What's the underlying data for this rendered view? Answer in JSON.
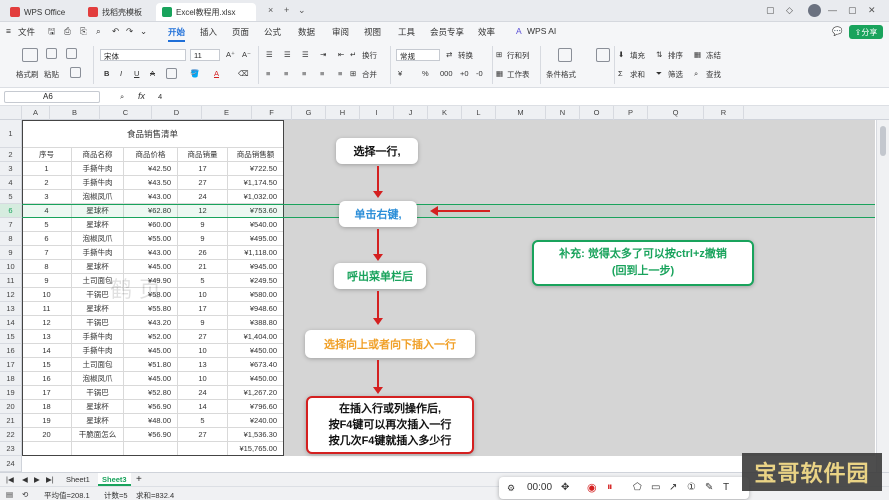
{
  "tabs": [
    {
      "label": "WPS Office",
      "icon_color": "#e23d3d"
    },
    {
      "label": "找稻壳模板",
      "icon_color": "#e23d3d"
    },
    {
      "label": "Excel教程用.xlsx",
      "icon_color": "#19a35c"
    }
  ],
  "menu": {
    "file": "文件",
    "items": [
      "开始",
      "插入",
      "页面",
      "公式",
      "数据",
      "审阅",
      "视图",
      "工具",
      "会员专享",
      "效率"
    ],
    "wps_ai": "WPS AI",
    "share": "分享"
  },
  "ribbon": {
    "format_painter": "格式刷",
    "paste": "粘贴",
    "font_name": "宋体",
    "font_size": "11",
    "wrap": "换行",
    "merge": "合并",
    "number_format": "常规",
    "convert": "转换",
    "row_col": "行和列",
    "worksheet": "工作表",
    "cond_format": "条件格式",
    "fill": "填充",
    "sort": "排序",
    "freeze": "冻结",
    "sum": "求和",
    "filter": "筛选",
    "find": "查找"
  },
  "formula_bar": {
    "cell_ref": "A6",
    "fx": "fx",
    "value": "4"
  },
  "columns": [
    "A",
    "B",
    "C",
    "D",
    "E",
    "F",
    "G",
    "H",
    "I",
    "J",
    "K",
    "L",
    "M",
    "N",
    "O",
    "P",
    "Q",
    "R"
  ],
  "rows": [
    "1",
    "2",
    "3",
    "4",
    "5",
    "6",
    "7",
    "8",
    "9",
    "10",
    "11",
    "12",
    "13",
    "14",
    "15",
    "16",
    "17",
    "18",
    "19",
    "20",
    "21",
    "22",
    "23",
    "24"
  ],
  "table": {
    "title": "食品销售清单",
    "headers": [
      "序号",
      "商品名称",
      "商品价格",
      "商品销量",
      "商品销售额"
    ],
    "data": [
      [
        "1",
        "手撕牛肉",
        "¥42.50",
        "17",
        "¥722.50"
      ],
      [
        "2",
        "手撕牛肉",
        "¥43.50",
        "27",
        "¥1,174.50"
      ],
      [
        "3",
        "泡椒凤爪",
        "¥43.00",
        "24",
        "¥1,032.00"
      ],
      [
        "4",
        "星球杯",
        "¥62.80",
        "12",
        "¥753.60"
      ],
      [
        "5",
        "星球杯",
        "¥60.00",
        "9",
        "¥540.00"
      ],
      [
        "6",
        "泡椒凤爪",
        "¥55.00",
        "9",
        "¥495.00"
      ],
      [
        "7",
        "手撕牛肉",
        "¥43.00",
        "26",
        "¥1,118.00"
      ],
      [
        "8",
        "星球杯",
        "¥45.00",
        "21",
        "¥945.00"
      ],
      [
        "9",
        "土司面包",
        "¥49.90",
        "5",
        "¥249.50"
      ],
      [
        "10",
        "干锅巴",
        "¥58.00",
        "10",
        "¥580.00"
      ],
      [
        "11",
        "星球杯",
        "¥55.80",
        "17",
        "¥948.60"
      ],
      [
        "12",
        "干锅巴",
        "¥43.20",
        "9",
        "¥388.80"
      ],
      [
        "13",
        "手撕牛肉",
        "¥52.00",
        "27",
        "¥1,404.00"
      ],
      [
        "14",
        "手撕牛肉",
        "¥45.00",
        "10",
        "¥450.00"
      ],
      [
        "15",
        "土司面包",
        "¥51.80",
        "13",
        "¥673.40"
      ],
      [
        "16",
        "泡椒凤爪",
        "¥45.00",
        "10",
        "¥450.00"
      ],
      [
        "17",
        "干锅巴",
        "¥52.80",
        "24",
        "¥1,267.20"
      ],
      [
        "18",
        "星球杯",
        "¥56.90",
        "14",
        "¥796.60"
      ],
      [
        "19",
        "星球杯",
        "¥48.00",
        "5",
        "¥240.00"
      ],
      [
        "20",
        "干脆面怎么",
        "¥56.90",
        "27",
        "¥1,536.30"
      ]
    ],
    "total": "¥15,765.00"
  },
  "watermark_text": "鹤 页",
  "annotations": {
    "step1": "选择一行,",
    "step2": "单击右键,",
    "step3": "呼出菜单栏后",
    "step4": "选择向上或者向下插入一行",
    "step5": "在插入行或列操作后,\n按F4键可以再次插入一行\n按几次F4键就插入多少行",
    "tip": "补充: 觉得太多了可以按ctrl+z撤销\n(回到上一步)"
  },
  "sheets": [
    "Sheet1",
    "Sheet3"
  ],
  "active_sheet": "Sheet3",
  "status": {
    "avg": "平均值=208.1",
    "count": "计数=5",
    "sum": "求和=832.4"
  },
  "recorder": {
    "time": "00:00"
  },
  "site_watermark": "宝哥软件园",
  "colors": {
    "accent": "#1f6fd8",
    "green": "#19a35c",
    "red": "#d42020",
    "orange": "#f0a028",
    "blue_text": "#2b8ed8"
  }
}
